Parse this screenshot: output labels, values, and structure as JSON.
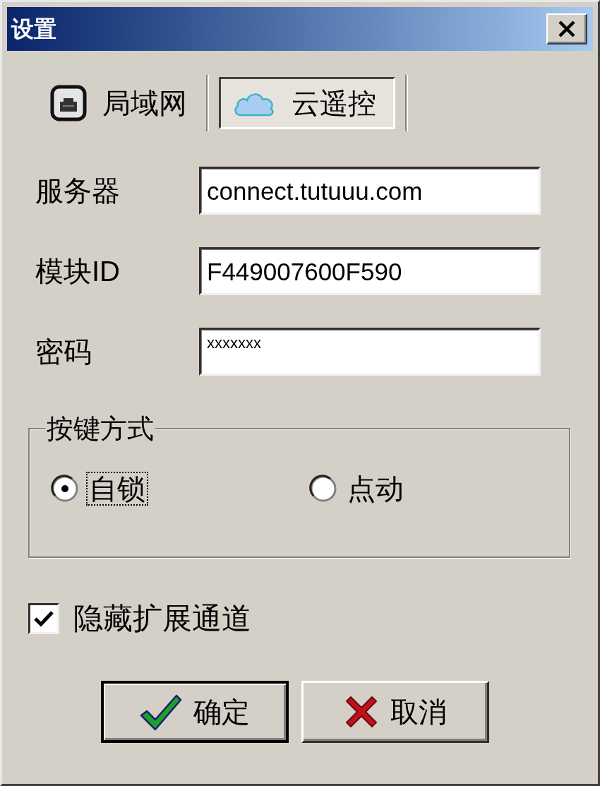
{
  "window": {
    "title": "设置"
  },
  "tabs": [
    {
      "label": "局域网",
      "kind": "lan",
      "selected": false
    },
    {
      "label": "云遥控",
      "kind": "cloud",
      "selected": true
    }
  ],
  "fields": [
    {
      "label": "服务器",
      "kind": "text",
      "value": "connect.tutuuu.com"
    },
    {
      "label": "模块ID",
      "kind": "text",
      "value": "F449007600F590"
    },
    {
      "label": "密码",
      "kind": "password",
      "value": "xxxxxxx"
    }
  ],
  "key_mode": {
    "title": "按键方式",
    "options": [
      {
        "label": "自锁",
        "selected": true,
        "focused": true
      },
      {
        "label": "点动",
        "selected": false,
        "focused": false
      }
    ]
  },
  "hide_extended_channels": {
    "label": "隐藏扩展通道",
    "checked": true
  },
  "buttons": [
    {
      "label": "确定",
      "kind": "ok",
      "default": true
    },
    {
      "label": "取消",
      "kind": "cancel",
      "default": false
    }
  ]
}
